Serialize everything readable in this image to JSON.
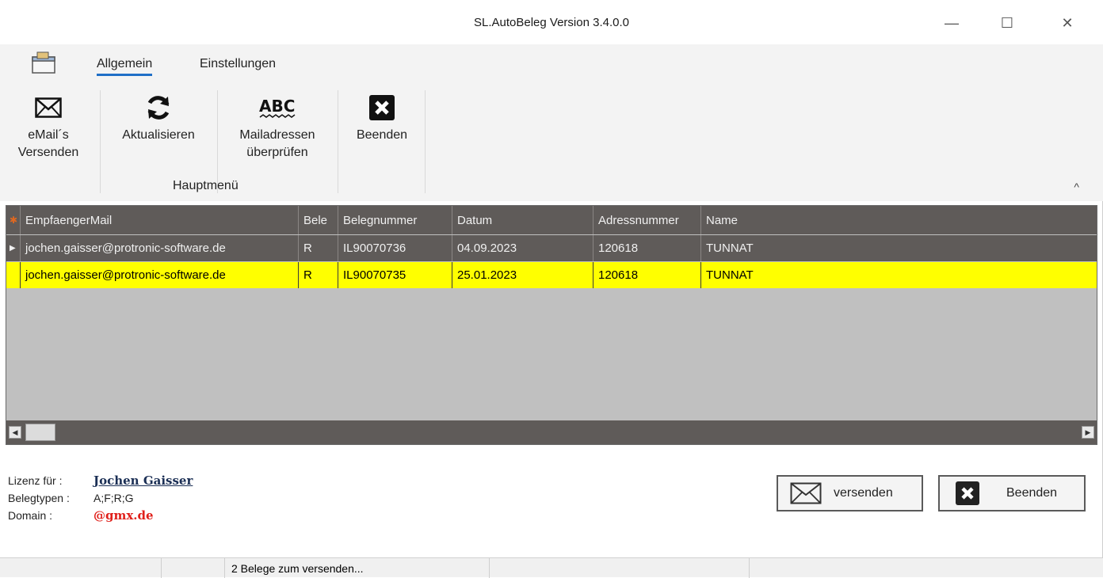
{
  "window": {
    "title": "SL.AutoBeleg Version 3.4.0.0",
    "min_glyph": "—",
    "max_glyph": "☐",
    "close_glyph": "✕"
  },
  "ribbon": {
    "tabs": [
      {
        "label": "Allgemein",
        "active": true
      },
      {
        "label": "Einstellungen",
        "active": false
      }
    ],
    "buttons": [
      {
        "label": "eMail´s Versenden",
        "icon": "envelope-icon"
      },
      {
        "label": "Aktualisieren",
        "icon": "refresh-icon"
      },
      {
        "label": "Mailadressen überprüfen",
        "icon": "spellcheck-abc-icon"
      },
      {
        "label": "Beenden",
        "icon": "close-box-icon"
      }
    ],
    "group_label": "Hauptmenü",
    "collapse_glyph": "^"
  },
  "grid": {
    "columns": [
      "EmpfaengerMail",
      "Bele",
      "Belegnummer",
      "Datum",
      "Adressnummer",
      "Name"
    ],
    "rows": [
      {
        "marker": "▶",
        "mail": "jochen.gaisser@protronic-software.de",
        "typ": "R",
        "nr": "IL90070736",
        "datum": "04.09.2023",
        "adr": "120618",
        "name": "TUNNAT",
        "selected": false
      },
      {
        "marker": "",
        "mail": "jochen.gaisser@protronic-software.de",
        "typ": "R",
        "nr": "IL90070735",
        "datum": "25.01.2023",
        "adr": "120618",
        "name": "TUNNAT",
        "selected": true
      }
    ],
    "header_marker": "✱"
  },
  "info": {
    "lizenz_label": "Lizenz für   :",
    "lizenz_value": "Jochen Gaisser",
    "typen_label": "Belegtypen :",
    "typen_value": "A;F;R;G",
    "domain_label": "Domain     :",
    "domain_value": "@gmx.de"
  },
  "footer_buttons": {
    "send_label": "versenden",
    "quit_label": "Beenden"
  },
  "statusbar": {
    "message": "2 Belege zum versenden..."
  },
  "colors": {
    "grid_header": "#5f5b59",
    "selected_row": "#ffff00",
    "grid_bg": "#c0c0c0",
    "domain_red": "#e0201b",
    "tab_underline": "#1f6fc7"
  }
}
